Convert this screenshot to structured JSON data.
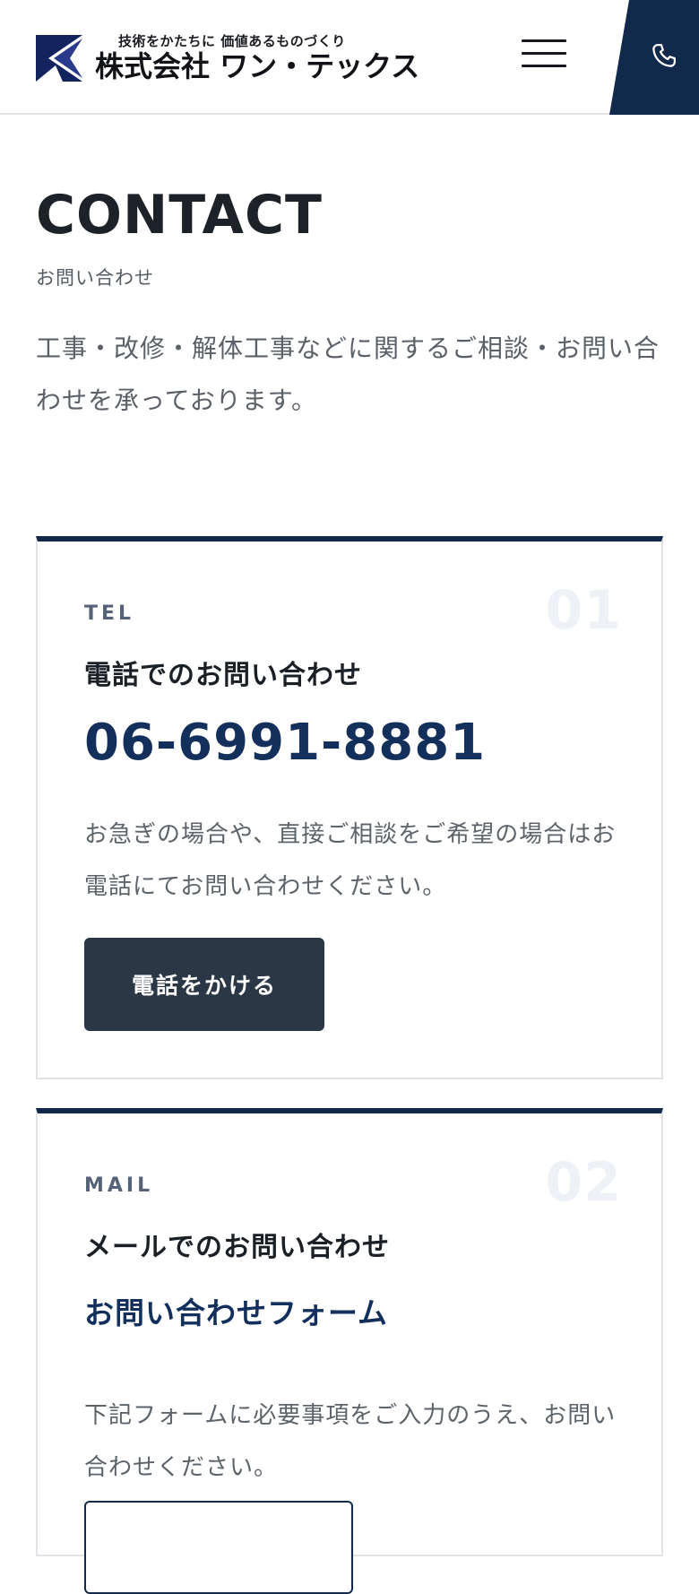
{
  "header": {
    "tagline": "技術をかたちに 価値あるものづくり",
    "company_name": "株式会社 ワン・テックス",
    "brand_color": "#13294a",
    "menu_icon": "hamburger-menu-icon",
    "phone_icon": "phone-icon"
  },
  "page": {
    "title": "CONTACT",
    "subtitle": "お問い合わせ",
    "intro": "工事・改修・解体工事などに関するご相談・お問い合わせを承っております。"
  },
  "tel_card": {
    "label": "TEL",
    "number": "01",
    "heading": "電話でのお問い合わせ",
    "phone": "06-6991-8881",
    "description": "お急ぎの場合や、直接ご相談をご希望の場合はお電話にてお問い合わせください。",
    "button_label": "電話をかける"
  },
  "mail_card": {
    "label": "MAIL",
    "number": "02",
    "heading": "メールでのお問い合わせ",
    "form_title": "お問い合わせフォーム",
    "description": "下記フォームに必要事項をご入力のうえ、お問い合わせください。",
    "button_label": ""
  }
}
